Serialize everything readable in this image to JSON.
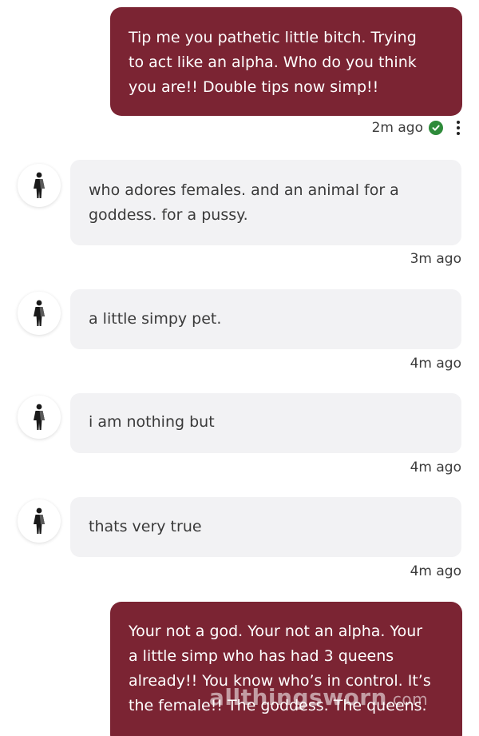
{
  "messages": [
    {
      "side": "outgoing",
      "text": "Tip me you pathetic little bitch. Trying\nto act like an alpha. Who do you think\nyou are!! Double tips now simp!!",
      "time": "2m ago",
      "status_icon": "check-circle-icon",
      "menu_icon": "kebab-menu-icon"
    },
    {
      "side": "incoming",
      "avatar_icon": "female-figure-icon",
      "text": "who adores females. and an animal for a\ngoddess. for a pussy.",
      "time": "3m ago"
    },
    {
      "side": "incoming",
      "avatar_icon": "female-figure-icon",
      "text": "a little simpy pet.",
      "time": "4m ago"
    },
    {
      "side": "incoming",
      "avatar_icon": "female-figure-icon",
      "text": "i am nothing but",
      "time": "4m ago"
    },
    {
      "side": "incoming",
      "avatar_icon": "female-figure-icon",
      "text": "thats very true",
      "time": "4m ago"
    },
    {
      "side": "outgoing",
      "text": "Your not a god. Your not an alpha. Your\na little simp who has had 3 queens\nalready!! You know who’s in control. It’s\nthe female!! The goddess. The queens."
    }
  ],
  "watermark": {
    "text": "allthingsworn",
    "suffix": ".com"
  },
  "colors": {
    "outgoing_bubble": "#7b2433",
    "incoming_bubble": "#f2f2f4",
    "read_check": "#2e8b3a"
  }
}
